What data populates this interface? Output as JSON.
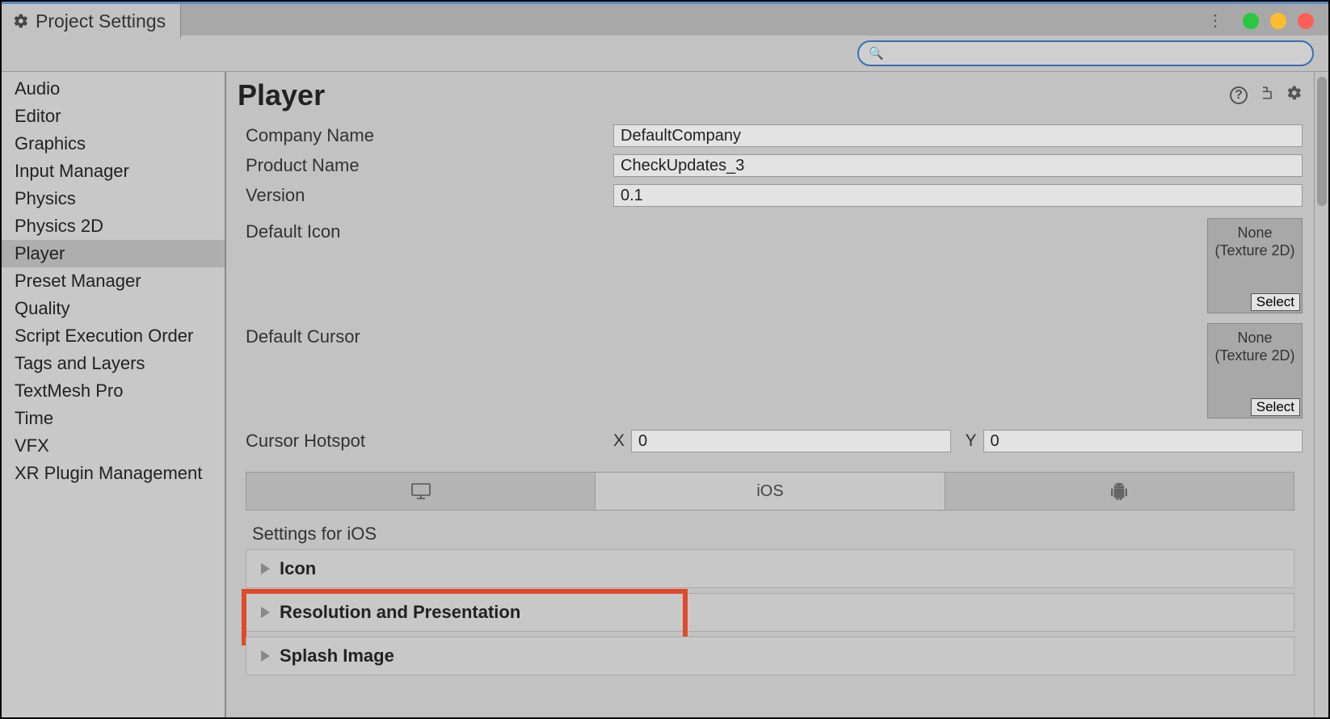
{
  "window": {
    "title": "Project Settings"
  },
  "search": {
    "placeholder": ""
  },
  "sidebar": {
    "items": [
      {
        "label": "Audio"
      },
      {
        "label": "Editor"
      },
      {
        "label": "Graphics"
      },
      {
        "label": "Input Manager"
      },
      {
        "label": "Physics"
      },
      {
        "label": "Physics 2D"
      },
      {
        "label": "Player",
        "selected": true
      },
      {
        "label": "Preset Manager"
      },
      {
        "label": "Quality"
      },
      {
        "label": "Script Execution Order"
      },
      {
        "label": "Tags and Layers"
      },
      {
        "label": "TextMesh Pro"
      },
      {
        "label": "Time"
      },
      {
        "label": "VFX"
      },
      {
        "label": "XR Plugin Management"
      }
    ]
  },
  "page": {
    "title": "Player",
    "company_name_label": "Company Name",
    "company_name_value": "DefaultCompany",
    "product_name_label": "Product Name",
    "product_name_value": "CheckUpdates_3",
    "version_label": "Version",
    "version_value": "0.1",
    "default_icon_label": "Default Icon",
    "default_cursor_label": "Default Cursor",
    "texture_none": "None",
    "texture_type": "(Texture 2D)",
    "texture_select": "Select",
    "cursor_hotspot_label": "Cursor Hotspot",
    "hotspot_x_label": "X",
    "hotspot_x_value": "0",
    "hotspot_y_label": "Y",
    "hotspot_y_value": "0"
  },
  "platform_tabs": {
    "desktop_label": "",
    "ios_label": "iOS",
    "android_label": ""
  },
  "settings": {
    "title": "Settings for iOS",
    "foldouts": [
      {
        "label": "Icon"
      },
      {
        "label": "Resolution and Presentation",
        "highlight": true
      },
      {
        "label": "Splash Image"
      }
    ]
  }
}
